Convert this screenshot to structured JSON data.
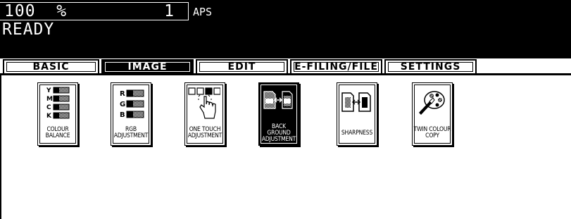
{
  "status": {
    "zoom": "100  %",
    "copies": "1",
    "paper_mode": "APS",
    "message": "READY"
  },
  "tabs": [
    {
      "label": "BASIC",
      "active": false
    },
    {
      "label": "IMAGE",
      "active": true
    },
    {
      "label": "EDIT",
      "active": false
    },
    {
      "label": "E-FILING/FILE",
      "active": false
    },
    {
      "label": "SETTINGS",
      "active": false
    }
  ],
  "functions": [
    {
      "label_lines": [
        "COLOUR BALANCE"
      ],
      "icon": "colour-balance-icon",
      "art_letters": [
        "Y",
        "M",
        "C",
        "K"
      ]
    },
    {
      "label_lines": [
        "RGB",
        "ADJUSTMENT"
      ],
      "icon": "rgb-adjustment-icon",
      "art_letters": [
        "R",
        "G",
        "B"
      ]
    },
    {
      "label_lines": [
        "ONE TOUCH",
        "ADJUSTMENT"
      ],
      "icon": "one-touch-adjustment-icon"
    },
    {
      "label_lines": [
        "BACK GROUND",
        "ADJUSTMENT"
      ],
      "icon": "background-adjustment-icon",
      "active": true
    },
    {
      "label_lines": [
        "SHARPNESS"
      ],
      "icon": "sharpness-icon"
    },
    {
      "label_lines": [
        "TWIN COLOUR",
        "COPY"
      ],
      "icon": "twin-colour-copy-icon"
    }
  ],
  "colors": {
    "screen_bg": "#ffffff",
    "status_bg": "#000000",
    "ink": "#000000"
  }
}
